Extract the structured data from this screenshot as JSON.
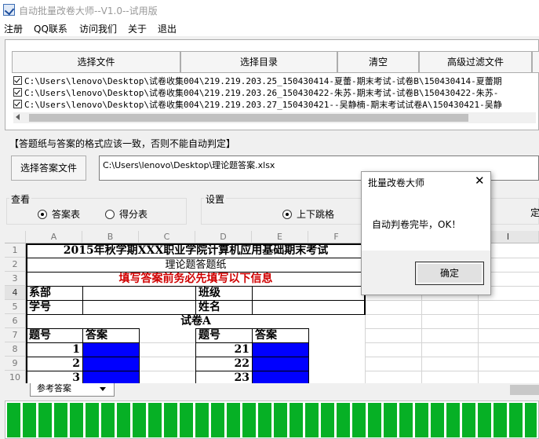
{
  "window": {
    "title": "自动批量改卷大师--V1.0--试用版"
  },
  "menu": [
    "注册",
    "QQ联系",
    "访问我们",
    "关于",
    "退出"
  ],
  "toolbar": {
    "select_file": "选择文件",
    "select_dir": "选择目录",
    "clear": "清空",
    "advanced_filter": "高级过滤文件"
  },
  "files": [
    "C:\\Users\\lenovo\\Desktop\\试卷收集004\\219.219.203.25_150430414-夏蕾-期末考试-试卷B\\150430414-夏蕾期",
    "C:\\Users\\lenovo\\Desktop\\试卷收集004\\219.219.203.26_150430422-朱苏-期末考试-试卷B\\150430422-朱苏-",
    "C:\\Users\\lenovo\\Desktop\\试卷收集004\\219.219.203.27_150430421--吴静楠-期末考试试卷A\\150430421-吴静"
  ],
  "answer": {
    "warning": "【答题纸与答案的格式应该一致，否则不能自动判定】",
    "button": "选择答案文件",
    "path": "C:\\Users\\lenovo\\Desktop\\理论题答案.xlsx"
  },
  "view": {
    "label": "查看",
    "opt1": "答案表",
    "opt2": "得分表"
  },
  "settings": {
    "label": "设置",
    "opt1": "上下跳格",
    "extra": "定"
  },
  "sheet": {
    "columns": [
      "A",
      "B",
      "C",
      "D",
      "E",
      "F",
      "I"
    ],
    "rows": [
      "1",
      "2",
      "3",
      "4",
      "5",
      "6",
      "7",
      "8",
      "9",
      "10"
    ],
    "r1": "2015年秋学期XXX职业学院计算机应用基础期末考试",
    "r2": "理论题答题纸",
    "r3": "填写答案前务必先填写以下信息",
    "r4a": "系部",
    "r4d": "班级",
    "r5a": "学号",
    "r5d": "姓名",
    "r6": "试卷A",
    "r7a": "题号",
    "r7b": "答案",
    "r7d": "题号",
    "r7e": "答案",
    "left_nums": [
      "1",
      "2",
      "3"
    ],
    "right_nums": [
      "21",
      "22",
      "23"
    ],
    "tab": "参考答案"
  },
  "progress": {
    "value": 1.0
  },
  "dialog": {
    "title": "批量改卷大师",
    "message": "自动判卷完毕，OK！",
    "ok": "确定"
  },
  "colors": {
    "red_text": "#d00000",
    "answer_fill": "#0000ff",
    "progress": "#06b025"
  }
}
